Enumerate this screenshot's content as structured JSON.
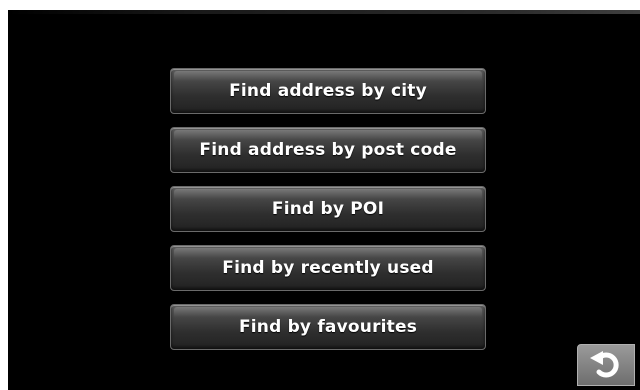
{
  "menu": {
    "items": [
      {
        "label": "Find address by city"
      },
      {
        "label": "Find address by post code"
      },
      {
        "label": "Find by POI"
      },
      {
        "label": "Find by recently used"
      },
      {
        "label": "Find by favourites"
      }
    ]
  },
  "back_button": {
    "icon": "back-arrow-icon"
  }
}
